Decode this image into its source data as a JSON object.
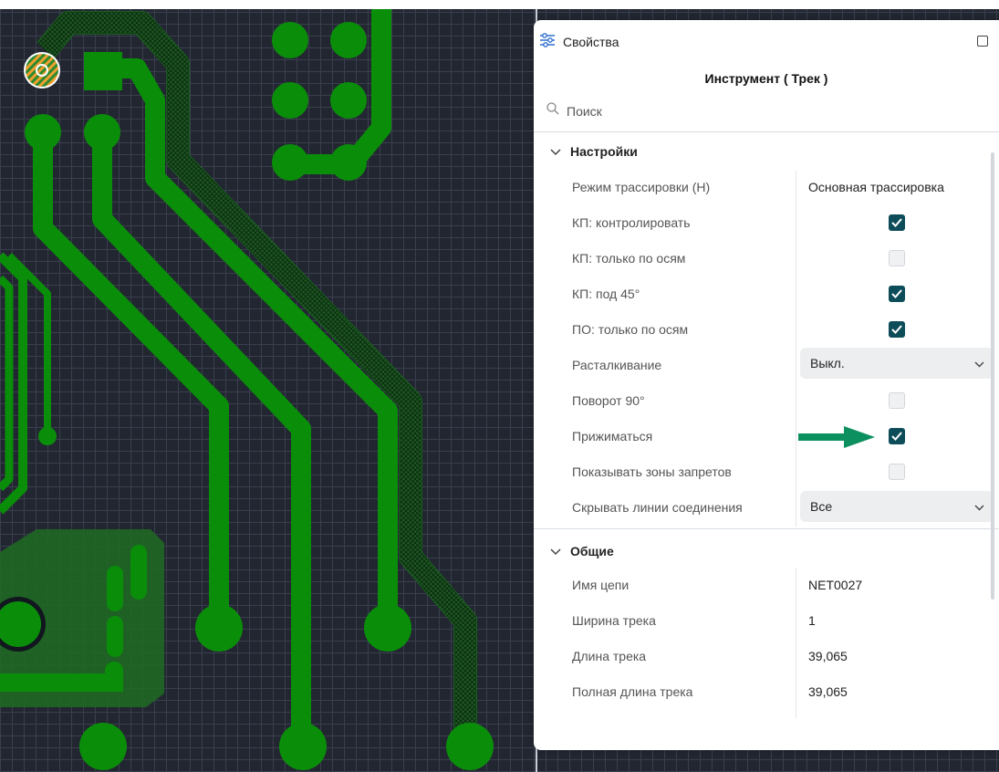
{
  "panel": {
    "title": "Свойства",
    "tool_title": "Инструмент ( Трек )",
    "search_placeholder": "Поиск"
  },
  "settings": {
    "header": "Настройки",
    "routing_mode": {
      "label": "Режим трассировки (H)",
      "value": "Основная трассировка"
    },
    "pad_control": {
      "label": "КП: контролировать",
      "checked": true
    },
    "pad_axes_only": {
      "label": "КП: только по осям",
      "checked": false
    },
    "pad_45": {
      "label": "КП: под 45°",
      "checked": true
    },
    "via_axes_only": {
      "label": "ПО: только по осям",
      "checked": true
    },
    "push": {
      "label": "Расталкивание",
      "value": "Выкл."
    },
    "rotate_90": {
      "label": "Поворот 90°",
      "checked": false
    },
    "hug": {
      "label": "Прижиматься",
      "checked": true
    },
    "show_keepouts": {
      "label": "Показывать зоны запретов",
      "checked": false
    },
    "hide_ratsnest": {
      "label": "Скрывать линии соединения",
      "value": "Все"
    }
  },
  "general": {
    "header": "Общие",
    "net_name": {
      "label": "Имя цепи",
      "value": "NET0027"
    },
    "track_width": {
      "label": "Ширина трека",
      "value": "1"
    },
    "track_length": {
      "label": "Длина трека",
      "value": "39,065"
    },
    "total_track_length": {
      "label": "Полная длина трека",
      "value": "39,065"
    }
  },
  "colors": {
    "track_green": "#008a00",
    "checkbox_on": "#0d4d59",
    "arrow": "#0d9060",
    "canvas_bg": "#222631"
  }
}
